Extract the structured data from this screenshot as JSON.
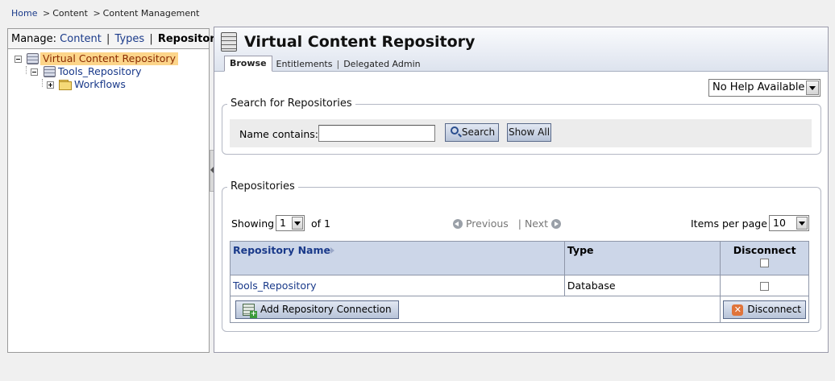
{
  "breadcrumb": {
    "home": "Home",
    "sep": ">",
    "content": "Content",
    "content_management": "Content Management"
  },
  "left": {
    "manage_label": "Manage:",
    "content": "Content",
    "types": "Types",
    "repositories": "Repositories",
    "pipe": "|",
    "tree": {
      "root": "Virtual Content Repository",
      "child": "Tools_Repository",
      "grandchild": "Workflows"
    }
  },
  "header": {
    "title": "Virtual Content Repository",
    "tabs": [
      "Browse",
      "Entitlements",
      "Delegated Admin"
    ],
    "tab_sep": "|"
  },
  "help": {
    "selected": "No Help Available"
  },
  "search": {
    "legend": "Search for Repositories",
    "label": "Name contains:",
    "value": "",
    "search_button": "Search",
    "show_all_button": "Show All"
  },
  "repositories": {
    "legend": "Repositories",
    "showing_label": "Showing",
    "page": "1",
    "of_label": "of 1",
    "previous": "Previous",
    "next": "Next",
    "nav_sep": "|",
    "items_per_page_label": "Items per page",
    "items_per_page": "10",
    "columns": {
      "name": "Repository Name",
      "type": "Type",
      "disconnect": "Disconnect"
    },
    "rows": [
      {
        "name": "Tools_Repository",
        "type": "Database"
      }
    ],
    "add_button": "Add Repository Connection",
    "disconnect_button": "Disconnect"
  }
}
